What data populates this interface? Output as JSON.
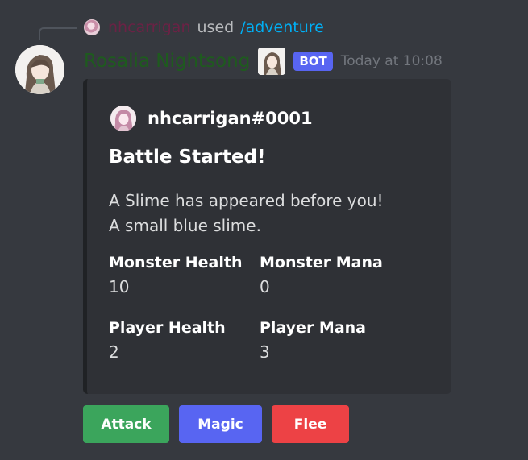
{
  "reply": {
    "username": "nhcarrigan",
    "used_text": "used",
    "command": "/adventure"
  },
  "message": {
    "author": "Rosalia Nightsong",
    "badge": "BOT",
    "timestamp": "Today at 10:08"
  },
  "embed": {
    "author_name": "nhcarrigan#0001",
    "title": "Battle Started!",
    "description_lines": [
      "A Slime has appeared before you!",
      "A small blue slime."
    ],
    "fields": [
      {
        "name": "Monster Health",
        "value": "10"
      },
      {
        "name": "Monster Mana",
        "value": "0"
      },
      {
        "name": "Player Health",
        "value": "2"
      },
      {
        "name": "Player Mana",
        "value": "3"
      }
    ]
  },
  "buttons": {
    "attack": "Attack",
    "magic": "Magic",
    "flee": "Flee"
  },
  "colors": {
    "background": "#36393f",
    "embed_background": "#2f3136",
    "embed_border": "#202225",
    "bot_badge": "#5865f2",
    "attack_button": "#3ba55c",
    "magic_button": "#5865f2",
    "flee_button": "#ed4245",
    "author_name": "#1e5b1e",
    "reply_username": "#6b2245",
    "command": "#00aff4"
  },
  "icons": {
    "reply_avatar": "user-avatar-icon",
    "author_avatar": "bot-avatar-icon",
    "embed_author_icon": "user-avatar-icon"
  }
}
